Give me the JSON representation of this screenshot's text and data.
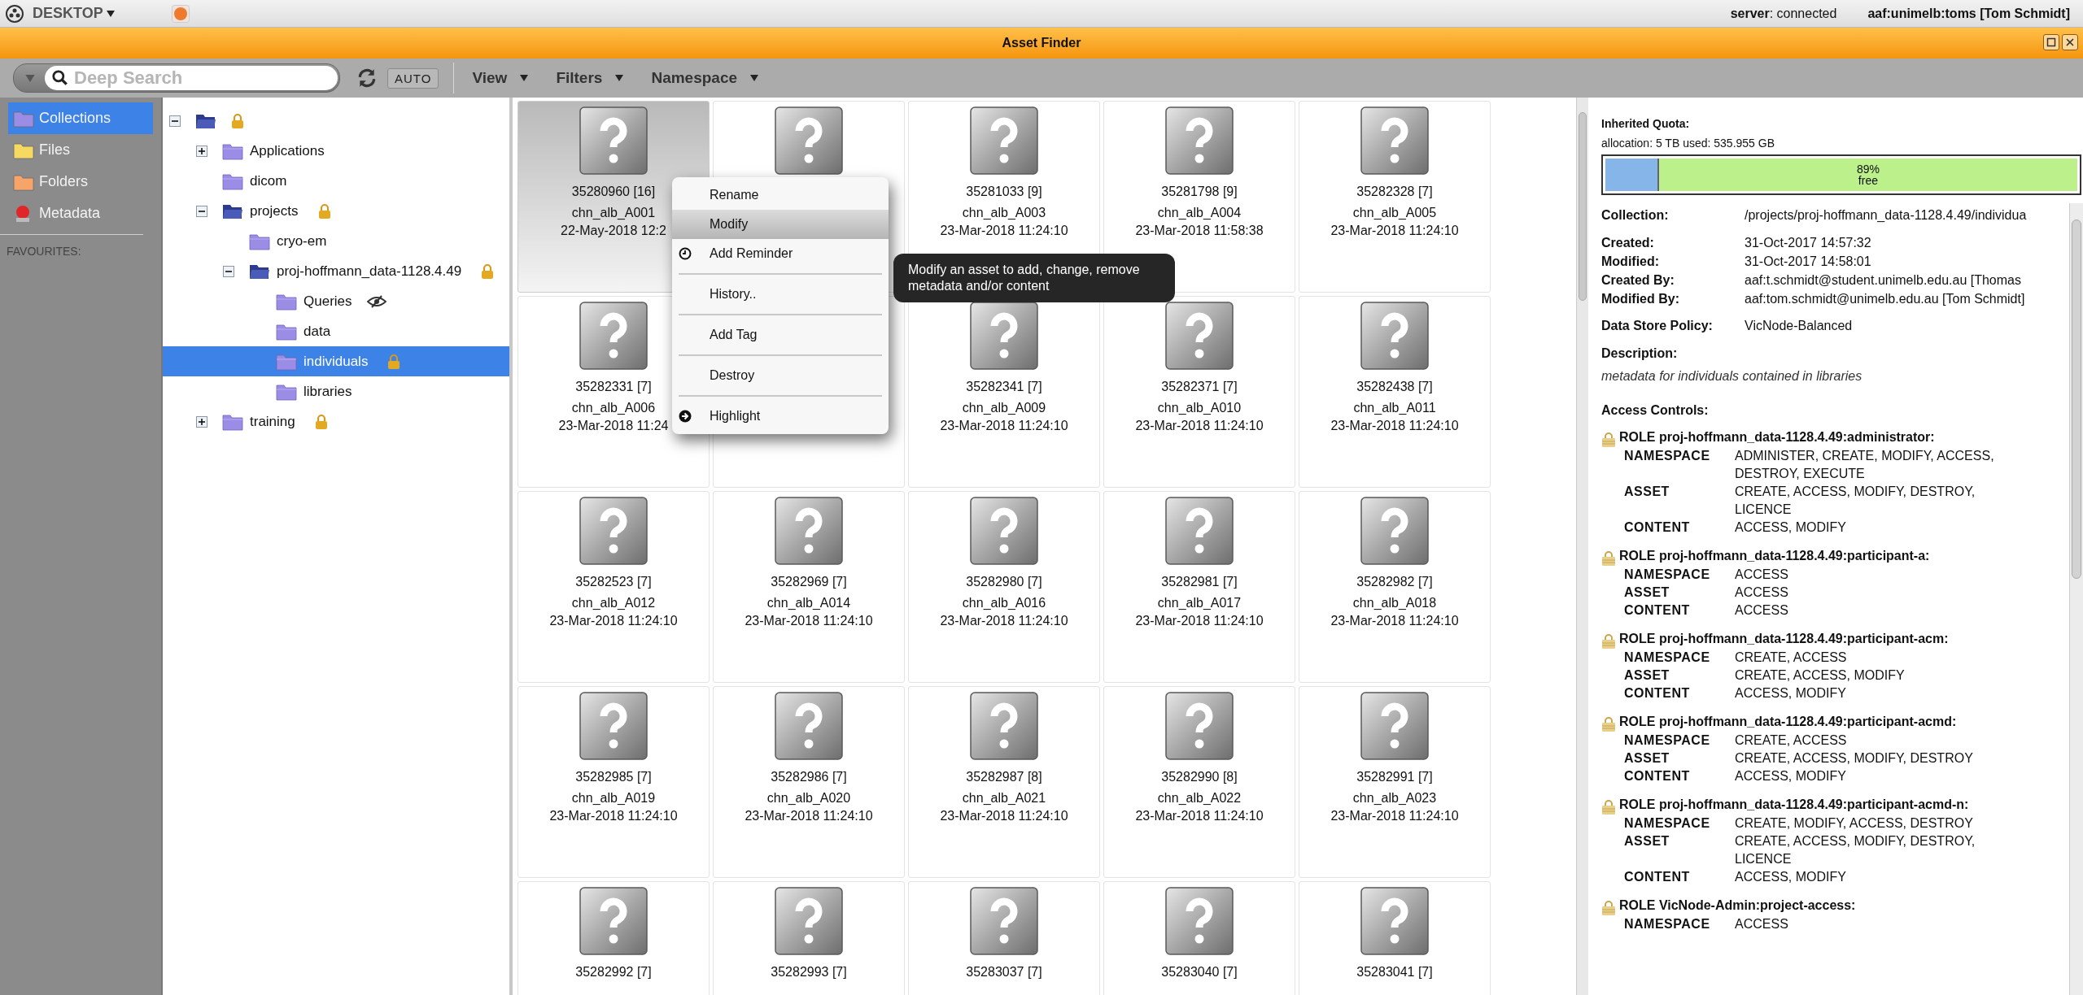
{
  "top_bar": {
    "desktop_label": "DESKTOP",
    "server_status": "**server**: connected",
    "user": "aaf:unimelb:toms [Tom Schmidt]"
  },
  "window": {
    "title": "Asset Finder"
  },
  "toolbar": {
    "search": {
      "placeholder": "Deep Search"
    },
    "auto": {
      "label": "AUTO"
    },
    "menus": [
      {
        "label": "View"
      },
      {
        "label": "Filters"
      },
      {
        "label": "Namespace"
      }
    ]
  },
  "sidebar": {
    "items": [
      {
        "label": "Collections",
        "kind": "folder",
        "color": "#9b8ce6",
        "selected": true
      },
      {
        "label": "Files",
        "kind": "folder",
        "color": "#f5d960",
        "selected": false
      },
      {
        "label": "Folders",
        "kind": "folder",
        "color": "#f7a46a",
        "selected": false
      },
      {
        "label": "Metadata",
        "kind": "badge",
        "color": "#e02626",
        "selected": false
      }
    ],
    "favourites_label": "FAVOURITES:"
  },
  "tree": {
    "root": {
      "expanded": true,
      "locked": true,
      "selected": false,
      "hidden": false,
      "children": [
        {
          "label": "Applications",
          "expanded": false,
          "locked": false,
          "selected": false,
          "hidden": false
        },
        {
          "label": "dicom",
          "locked": false,
          "selected": false,
          "hidden": false
        },
        {
          "label": "projects",
          "expanded": true,
          "locked": true,
          "selected": false,
          "hidden": false,
          "children": [
            {
              "label": "cryo-em",
              "locked": false,
              "selected": false,
              "hidden": false
            },
            {
              "label": "proj-hoffmann_data-1128.4.49",
              "expanded": true,
              "locked": true,
              "selected": false,
              "hidden": false,
              "children": [
                {
                  "label": "Queries",
                  "locked": false,
                  "selected": false,
                  "hidden": true
                },
                {
                  "label": "data",
                  "locked": false,
                  "selected": false,
                  "hidden": false
                },
                {
                  "label": "individuals",
                  "locked": true,
                  "selected": true,
                  "hidden": false
                },
                {
                  "label": "libraries",
                  "locked": false,
                  "selected": false,
                  "hidden": false
                }
              ]
            }
          ]
        },
        {
          "label": "training",
          "expanded": false,
          "locked": true,
          "selected": false,
          "hidden": false
        }
      ]
    }
  },
  "assets": [
    {
      "kind": "asset",
      "id": "35280960 [16]",
      "name": "chn_alb_A001",
      "date": "22-May-2018 12:2",
      "selected": true
    },
    {
      "kind": "icon-only",
      "selected": false
    },
    {
      "kind": "asset",
      "id": "35281033 [9]",
      "name": "chn_alb_A003",
      "date": "23-Mar-2018 11:24:10",
      "selected": false
    },
    {
      "kind": "asset",
      "id": "35281798 [9]",
      "name": "chn_alb_A004",
      "date": "23-Mar-2018 11:58:38",
      "selected": false
    },
    {
      "kind": "asset",
      "id": "35282328 [7]",
      "name": "chn_alb_A005",
      "date": "23-Mar-2018 11:24:10",
      "selected": false
    },
    {
      "kind": "asset",
      "id": "35282331 [7]",
      "name": "chn_alb_A006",
      "date": "23-Mar-2018 11:24",
      "selected": false
    },
    {
      "kind": "hidden",
      "selected": false
    },
    {
      "kind": "asset",
      "id": "35282341 [7]",
      "name": "chn_alb_A009",
      "date": "23-Mar-2018 11:24:10",
      "selected": false
    },
    {
      "kind": "asset",
      "id": "35282371 [7]",
      "name": "chn_alb_A010",
      "date": "23-Mar-2018 11:24:10",
      "selected": false
    },
    {
      "kind": "asset",
      "id": "35282438 [7]",
      "name": "chn_alb_A011",
      "date": "23-Mar-2018 11:24:10",
      "selected": false
    },
    {
      "kind": "asset",
      "id": "35282523 [7]",
      "name": "chn_alb_A012",
      "date": "23-Mar-2018 11:24:10",
      "selected": false
    },
    {
      "kind": "asset",
      "id": "35282969 [7]",
      "name": "chn_alb_A014",
      "date": "23-Mar-2018 11:24:10",
      "selected": false
    },
    {
      "kind": "asset",
      "id": "35282980 [7]",
      "name": "chn_alb_A016",
      "date": "23-Mar-2018 11:24:10",
      "selected": false
    },
    {
      "kind": "asset",
      "id": "35282981 [7]",
      "name": "chn_alb_A017",
      "date": "23-Mar-2018 11:24:10",
      "selected": false
    },
    {
      "kind": "asset",
      "id": "35282982 [7]",
      "name": "chn_alb_A018",
      "date": "23-Mar-2018 11:24:10",
      "selected": false
    },
    {
      "kind": "asset",
      "id": "35282985 [7]",
      "name": "chn_alb_A019",
      "date": "23-Mar-2018 11:24:10",
      "selected": false
    },
    {
      "kind": "asset",
      "id": "35282986 [7]",
      "name": "chn_alb_A020",
      "date": "23-Mar-2018 11:24:10",
      "selected": false
    },
    {
      "kind": "asset",
      "id": "35282987 [8]",
      "name": "chn_alb_A021",
      "date": "23-Mar-2018 11:24:10",
      "selected": false
    },
    {
      "kind": "asset",
      "id": "35282990 [8]",
      "name": "chn_alb_A022",
      "date": "23-Mar-2018 11:24:10",
      "selected": false
    },
    {
      "kind": "asset",
      "id": "35282991 [7]",
      "name": "chn_alb_A023",
      "date": "23-Mar-2018 11:24:10",
      "selected": false
    },
    {
      "kind": "asset",
      "id": "35282992 [7]",
      "selected": false
    },
    {
      "kind": "asset",
      "id": "35282993 [7]",
      "selected": false
    },
    {
      "kind": "asset",
      "id": "35283037 [7]",
      "selected": false
    },
    {
      "kind": "asset",
      "id": "35283040 [7]",
      "selected": false
    },
    {
      "kind": "asset",
      "id": "35283041 [7]",
      "selected": false
    }
  ],
  "context_menu": {
    "items": [
      {
        "label": "Rename",
        "kind": "plain",
        "selected": false,
        "separator_after": false
      },
      {
        "label": "Modify",
        "kind": "plain",
        "selected": true,
        "separator_after": false
      },
      {
        "label": "Add Reminder",
        "kind": "reminder",
        "selected": false,
        "separator_after": true
      },
      {
        "label": "History..",
        "kind": "plain",
        "selected": false,
        "separator_after": true
      },
      {
        "label": "Add Tag",
        "kind": "plain",
        "selected": false,
        "separator_after": true
      },
      {
        "label": "Destroy",
        "kind": "plain",
        "selected": false,
        "separator_after": true
      },
      {
        "label": "Highlight",
        "kind": "highlight",
        "selected": false,
        "separator_after": false
      }
    ]
  },
  "tooltip": {
    "text": "Modify an asset to add, change, remove metadata and/or content"
  },
  "details": {
    "quota": {
      "title": "Inherited Quota:",
      "allocation": "allocation: 5 TB used: 535.955 GB",
      "level": 0.11,
      "free_percent": "89%",
      "free_label": "free"
    },
    "collection": {
      "label": "Collection:",
      "value": "/projects/proj-hoffmann_data-1128.4.49/individua"
    },
    "dates": [
      {
        "label": "Created:",
        "value": "31-Oct-2017 14:57:32"
      },
      {
        "label": "Modified:",
        "value": "31-Oct-2017 14:58:01"
      },
      {
        "label": "Created By:",
        "value": "aaf:t.schmidt@student.unimelb.edu.au [Thomas"
      },
      {
        "label": "Modified By:",
        "value": "aaf:tom.schmidt@unimelb.edu.au [Tom Schmidt]"
      }
    ],
    "policy": {
      "label": "Data Store Policy:",
      "value": "VicNode-Balanced"
    },
    "description": {
      "label": "Description:",
      "text": "metadata for individuals contained in libraries"
    },
    "access": {
      "title": "Access Controls:",
      "roles": [
        {
          "name": "ROLE proj-hoffmann_data-1128.4.49:administrator:",
          "permissions": [
            {
              "type": "NAMESPACE",
              "value": "ADMINISTER, CREATE, MODIFY, ACCESS, DESTROY, EXECUTE"
            },
            {
              "type": "ASSET",
              "value": "CREATE, ACCESS, MODIFY, DESTROY, LICENCE"
            },
            {
              "type": "CONTENT",
              "value": "ACCESS, MODIFY"
            }
          ]
        },
        {
          "name": "ROLE proj-hoffmann_data-1128.4.49:participant-a:",
          "permissions": [
            {
              "type": "NAMESPACE",
              "value": "ACCESS"
            },
            {
              "type": "ASSET",
              "value": "ACCESS"
            },
            {
              "type": "CONTENT",
              "value": "ACCESS"
            }
          ]
        },
        {
          "name": "ROLE proj-hoffmann_data-1128.4.49:participant-acm:",
          "permissions": [
            {
              "type": "NAMESPACE",
              "value": "CREATE, ACCESS"
            },
            {
              "type": "ASSET",
              "value": "CREATE, ACCESS, MODIFY"
            },
            {
              "type": "CONTENT",
              "value": "ACCESS, MODIFY"
            }
          ]
        },
        {
          "name": "ROLE proj-hoffmann_data-1128.4.49:participant-acmd:",
          "permissions": [
            {
              "type": "NAMESPACE",
              "value": "CREATE, ACCESS"
            },
            {
              "type": "ASSET",
              "value": "CREATE, ACCESS, MODIFY, DESTROY"
            },
            {
              "type": "CONTENT",
              "value": "ACCESS, MODIFY"
            }
          ]
        },
        {
          "name": "ROLE proj-hoffmann_data-1128.4.49:participant-acmd-n:",
          "permissions": [
            {
              "type": "NAMESPACE",
              "value": "CREATE, MODIFY, ACCESS, DESTROY"
            },
            {
              "type": "ASSET",
              "value": "CREATE, ACCESS, MODIFY, DESTROY, LICENCE"
            },
            {
              "type": "CONTENT",
              "value": "ACCESS, MODIFY"
            }
          ]
        },
        {
          "name": "ROLE VicNode-Admin:project-access:",
          "permissions": [
            {
              "type": "NAMESPACE",
              "value": "ACCESS"
            }
          ]
        }
      ]
    }
  }
}
